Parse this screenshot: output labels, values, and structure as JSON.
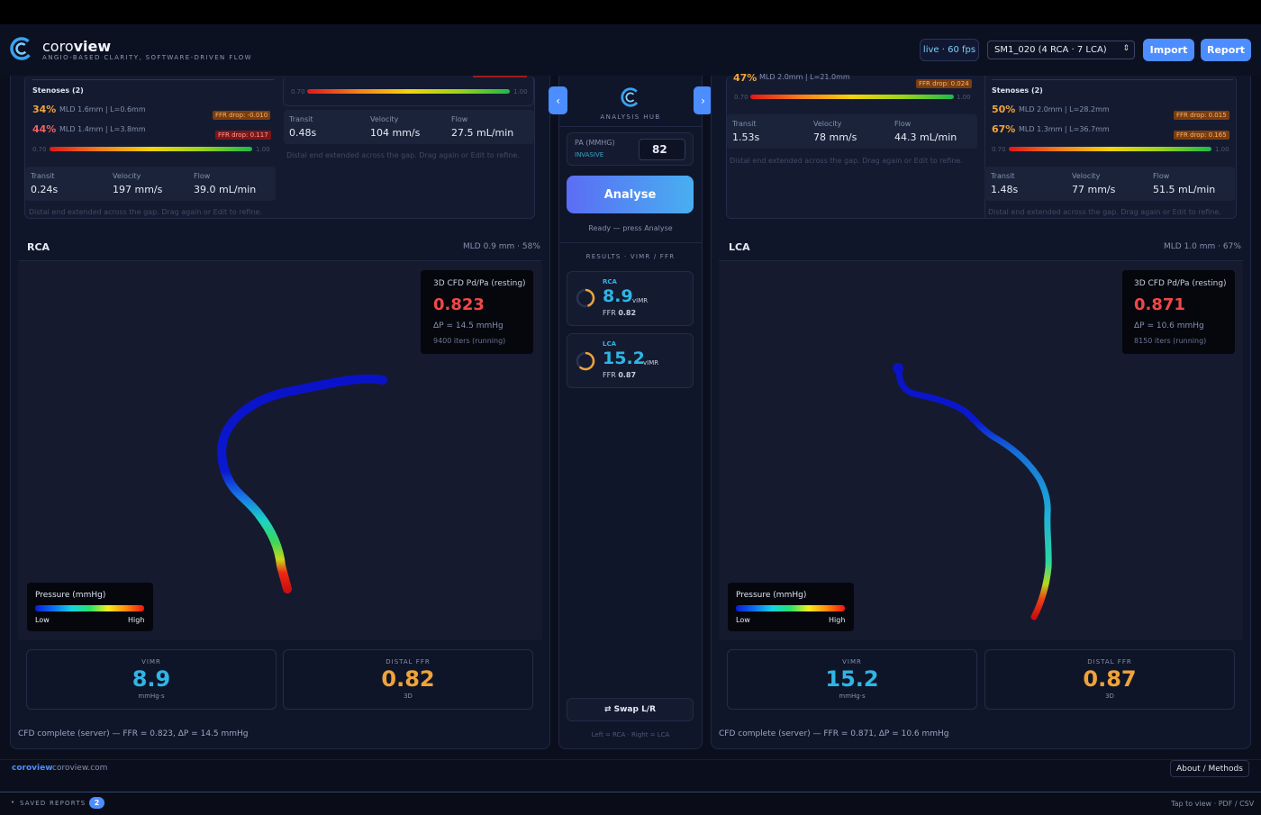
{
  "header": {
    "brand_light": "coro",
    "brand_bold": "view",
    "tagline": "ANGIO-BASED CLARITY, SOFTWARE-DRIVEN FLOW",
    "live": "live · 60 fps",
    "case_select": "SM1_020 (4 RCA · 7 LCA)",
    "import_label": "Import",
    "report_label": "Report"
  },
  "left_top": {
    "stenoses_title": "Stenoses (2)",
    "stenoses": [
      {
        "pct": "34%",
        "desc": "MLD 1.6mm | L=0.6mm",
        "drop": "FFR drop: -0.010"
      },
      {
        "pct": "44%",
        "desc": "MLD 1.4mm | L=3.8mm",
        "drop": "FFR drop: 0.117"
      }
    ],
    "scale_min": "0.70",
    "scale_max": "1.00",
    "stats": [
      {
        "label": "Transit",
        "value": "0.24s"
      },
      {
        "label": "Velocity",
        "value": "197 mm/s"
      },
      {
        "label": "Flow",
        "value": "39.0 mL/min"
      }
    ],
    "note": "Distal end extended across the gap. Drag again or Edit to refine.",
    "card2_scale_min": "0.70",
    "card2_scale_max": "1.00",
    "card2_stats": [
      {
        "label": "Transit",
        "value": "0.48s"
      },
      {
        "label": "Velocity",
        "value": "104 mm/s"
      },
      {
        "label": "Flow",
        "value": "27.5 mL/min"
      }
    ],
    "card2_note": "Distal end extended across the gap. Drag again or Edit to refine."
  },
  "right_top": {
    "partial_pct": "47%",
    "partial_desc": "MLD 2.0mm | L=21.0mm",
    "partial_drop": "FFR drop: 0.024",
    "card1_scale_min": "0.70",
    "card1_scale_max": "1.00",
    "card1_stats": [
      {
        "label": "Transit",
        "value": "1.53s"
      },
      {
        "label": "Velocity",
        "value": "78 mm/s"
      },
      {
        "label": "Flow",
        "value": "44.3 mL/min"
      }
    ],
    "card1_note": "Distal end extended across the gap. Drag again or Edit to refine.",
    "stenoses_title": "Stenoses (2)",
    "stenoses": [
      {
        "pct": "50%",
        "desc": "MLD 2.0mm | L=28.2mm",
        "drop": "FFR drop: 0.015"
      },
      {
        "pct": "67%",
        "desc": "MLD 1.3mm | L=36.7mm",
        "drop": "FFR drop: 0.165"
      }
    ],
    "scale_min": "0.70",
    "scale_max": "1.00",
    "stats": [
      {
        "label": "Transit",
        "value": "1.48s"
      },
      {
        "label": "Velocity",
        "value": "77 mm/s"
      },
      {
        "label": "Flow",
        "value": "51.5 mL/min"
      }
    ],
    "note": "Distal end extended across the gap. Drag again or Edit to refine."
  },
  "rca": {
    "title": "RCA",
    "mld": "MLD 0.9 mm · 58%",
    "cfd_title": "3D CFD Pd/Pa (resting)",
    "cfd_value": "0.823",
    "delta_p": "ΔP = 14.5 mmHg",
    "iters": "9400 iters (running)",
    "legend_title": "Pressure (mmHg)",
    "legend_low": "Low",
    "legend_high": "High",
    "vimr_label": "VIMR",
    "vimr_value": "8.9",
    "vimr_unit": "mmHg·s",
    "ffr_label": "DISTAL FFR",
    "ffr_value": "0.82",
    "ffr_unit": "3D",
    "status": "CFD complete (server) — FFR = 0.823, ΔP = 14.5 mmHg"
  },
  "lca": {
    "title": "LCA",
    "mld": "MLD 1.0 mm · 67%",
    "cfd_title": "3D CFD Pd/Pa (resting)",
    "cfd_value": "0.871",
    "delta_p": "ΔP = 10.6 mmHg",
    "iters": "8150 iters (running)",
    "legend_title": "Pressure (mmHg)",
    "legend_low": "Low",
    "legend_high": "High",
    "vimr_label": "VIMR",
    "vimr_value": "15.2",
    "vimr_unit": "mmHg·s",
    "ffr_label": "DISTAL FFR",
    "ffr_value": "0.87",
    "ffr_unit": "3D",
    "status": "CFD complete (server) — FFR = 0.871, ΔP = 10.6 mmHg"
  },
  "hub": {
    "title": "ANALYSIS HUB",
    "pa_label": "PA (MMHG)",
    "pa_sub": "INVASIVE",
    "pa_value": "82",
    "analyse_label": "Analyse",
    "ready_text": "Ready — press Analyse",
    "results_title": "RESULTS · VIMR / FFR",
    "results": [
      {
        "vessel": "RCA",
        "vimr": "8.9",
        "unit": "vIMR",
        "ffr_label": "FFR",
        "ffr": "0.82",
        "ring_fraction": 0.45
      },
      {
        "vessel": "LCA",
        "vimr": "15.2",
        "unit": "vIMR",
        "ffr_label": "FFR",
        "ffr": "0.87",
        "ring_fraction": 0.62
      }
    ],
    "swap_label": "⇄ Swap L/R",
    "swap_hint": "Left = RCA · Right = LCA"
  },
  "footer": {
    "brand": "coroview",
    "domain": "coroview.com",
    "about_label": "About / Methods"
  },
  "bottom": {
    "saved_label": "SAVED REPORTS",
    "saved_count": "2",
    "hint": "Tap to view · PDF / CSV"
  },
  "colors": {
    "accent": "#4c8dff",
    "vimr": "#2fb5e6",
    "ffr": "#f0a33a",
    "cfd_value": "#f04848"
  }
}
